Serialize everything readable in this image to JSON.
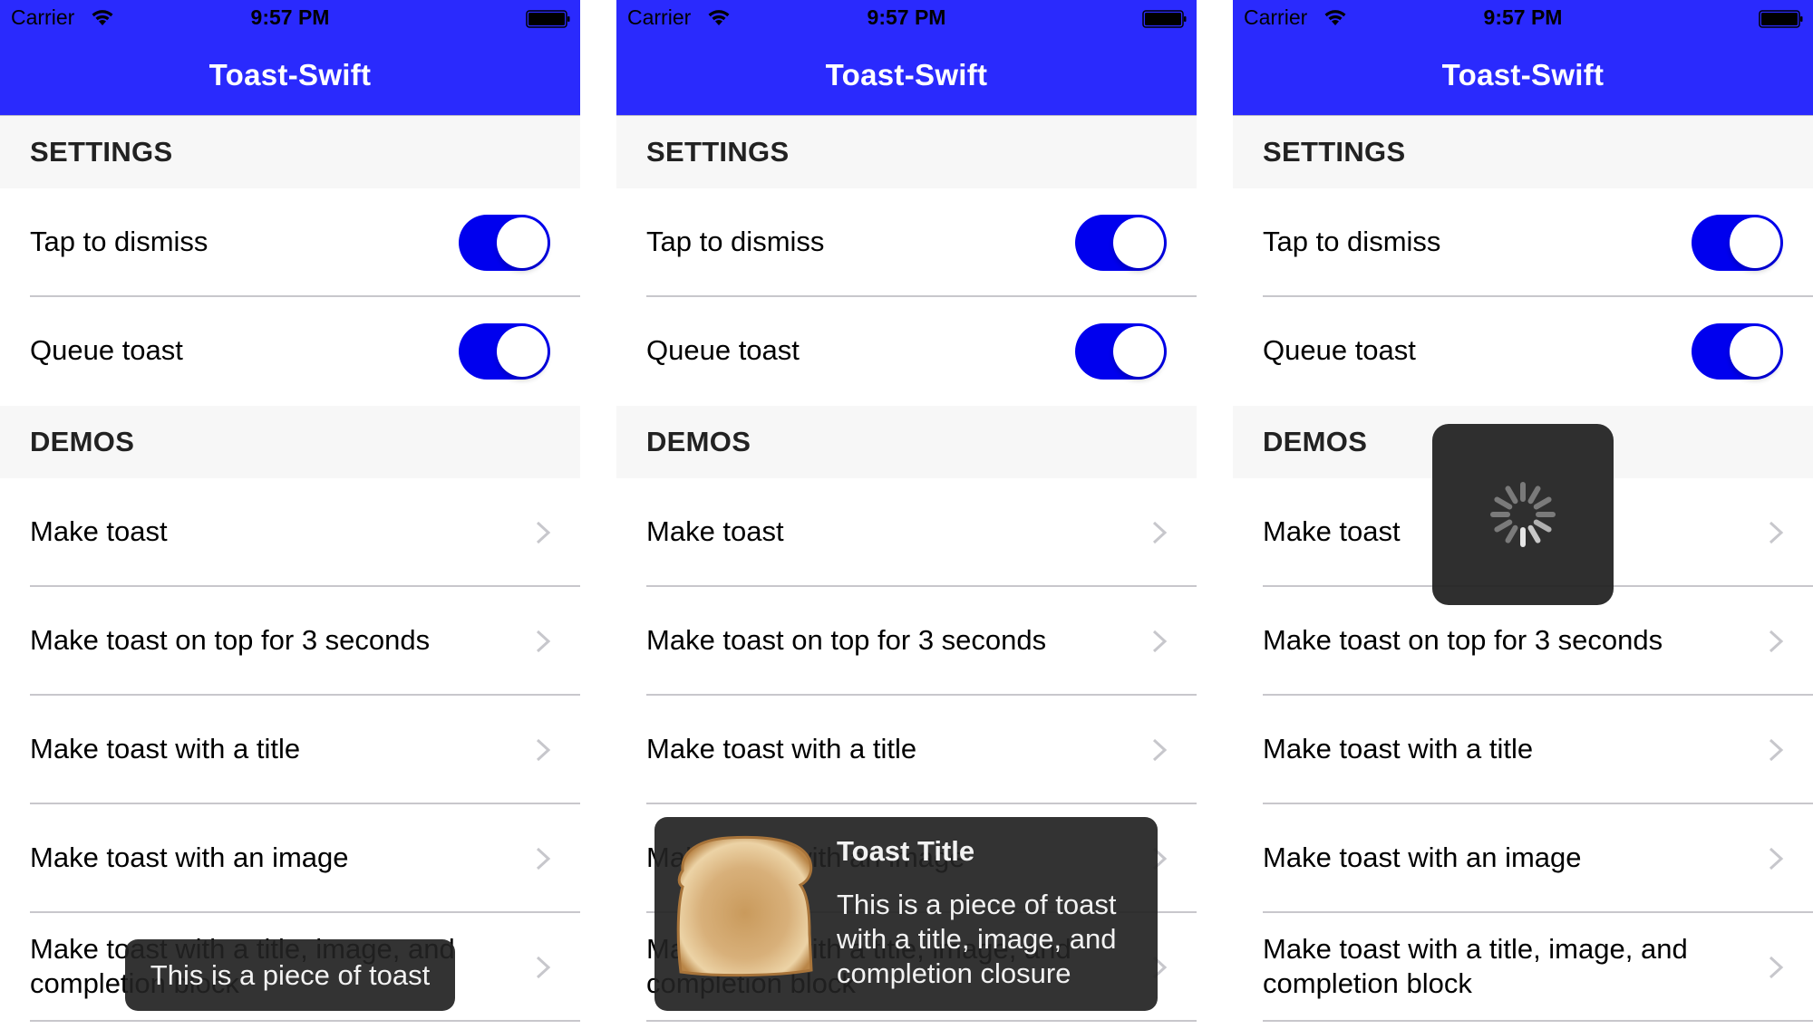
{
  "status_bar": {
    "carrier": "Carrier",
    "time": "9:57 PM",
    "wifi_icon": "wifi-icon",
    "battery_icon": "battery-full-icon"
  },
  "nav": {
    "title": "Toast-Swift",
    "color": "#2a2afd"
  },
  "settings": {
    "header": "SETTINGS",
    "items": [
      {
        "label": "Tap to dismiss",
        "on": true
      },
      {
        "label": "Queue toast",
        "on": true
      }
    ],
    "toggle_color": "#0000ee"
  },
  "demos": {
    "header": "DEMOS",
    "items": [
      {
        "label": "Make toast"
      },
      {
        "label": "Make toast on top for 3 seconds"
      },
      {
        "label": "Make toast with a title"
      },
      {
        "label": "Make toast with an image"
      },
      {
        "label": "Make toast with a title, image, and completion block"
      }
    ],
    "chevron_icon": "chevron-right-icon"
  },
  "panels": [
    {
      "overlay": "toast",
      "toast": {
        "message": "This is a piece of toast"
      }
    },
    {
      "overlay": "toast-rich",
      "toast": {
        "title": "Toast Title",
        "message": "This is a piece of toast with a title, image, and completion closure",
        "image": "toast-bread-image"
      }
    },
    {
      "overlay": "activity",
      "activity": {
        "icon": "activity-spinner-icon"
      }
    }
  ]
}
